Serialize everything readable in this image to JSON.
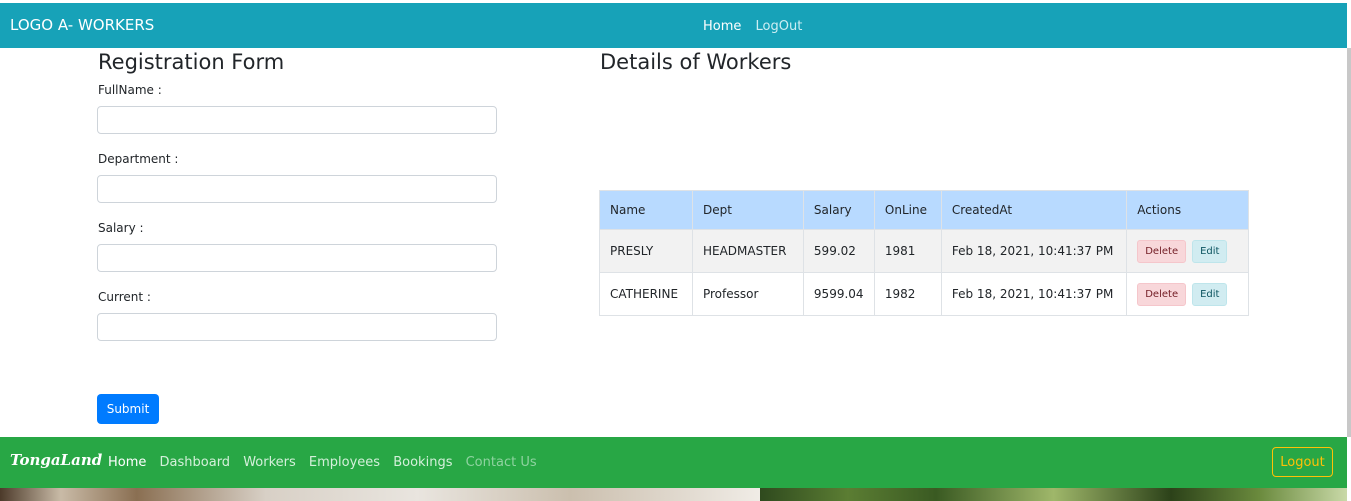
{
  "header": {
    "brand": "LOGO A- WORKERS",
    "nav": [
      "Home",
      "LogOut"
    ]
  },
  "form": {
    "title": "Registration Form",
    "fields": [
      {
        "label": "FullName :",
        "value": ""
      },
      {
        "label": "Department :",
        "value": ""
      },
      {
        "label": "Salary :",
        "value": ""
      },
      {
        "label": "Current :",
        "value": ""
      }
    ],
    "submit_label": "Submit"
  },
  "details": {
    "title": "Details of Workers",
    "columns": [
      "Name",
      "Dept",
      "Salary",
      "OnLine",
      "CreatedAt",
      "Actions"
    ],
    "rows": [
      {
        "name": "PRESLY",
        "dept": "HEADMASTER",
        "salary": "599.02",
        "online": "1981",
        "created": "Feb 18, 2021, 10:41:37 PM",
        "delete": "Delete",
        "edit": "Edit"
      },
      {
        "name": "CATHERINE",
        "dept": "Professor",
        "salary": "9599.04",
        "online": "1982",
        "created": "Feb 18, 2021, 10:41:37 PM",
        "delete": "Delete",
        "edit": "Edit"
      }
    ]
  },
  "footer": {
    "logo": "TongaLand",
    "nav": [
      "Home",
      "Dashboard",
      "Workers",
      "Employees",
      "Bookings",
      "Contact Us"
    ],
    "logout_label": "Logout"
  },
  "colors": {
    "header_bg": "#17a2b8",
    "footer_bg": "#28a745",
    "table_header_bg": "#b8daff",
    "submit_bg": "#007bff",
    "logout_border": "#ffc107"
  }
}
